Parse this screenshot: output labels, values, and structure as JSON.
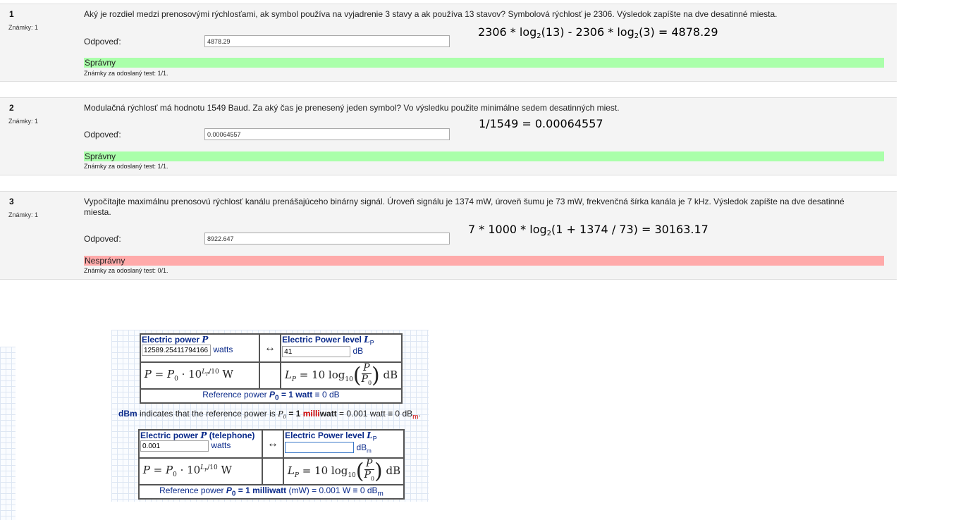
{
  "questions": [
    {
      "number": "1",
      "marks": "Známky: 1",
      "text": "Aký je rozdiel medzi prenosovými rýchlosťami, ak symbol používa na vyjadrenie 3 stavy a ak používa 13 stavov? Symbolová rýchlosť je 2306. Výsledok zapíšte na dve desatinné miesta.",
      "answer_label": "Odpoveď:",
      "answer_value": "4878.29",
      "annotation_prefix": "2306 * log",
      "annotation_mid1": "(13) - 2306 * log",
      "annotation_suffix": "(3) = 4878.29",
      "annotation_sub": "2",
      "result": "Správny",
      "status": "correct",
      "score": "Známky za odoslaný test: 1/1."
    },
    {
      "number": "2",
      "marks": "Známky: 1",
      "text": "Modulačná rýchlosť má hodnotu 1549 Baud. Za aký čas je prenesený jeden symbol? Vo výsledku použite minimálne sedem desatinných miest.",
      "answer_label": "Odpoveď:",
      "answer_value": "0.00064557",
      "annotation": "1/1549 = 0.00064557",
      "result": "Správny",
      "status": "correct",
      "score": "Známky za odoslaný test: 1/1."
    },
    {
      "number": "3",
      "marks": "Známky: 1",
      "text": "Vypočítajte maximálnu prenosovú rýchlosť kanálu prenášajúceho binárny signál. Úroveň signálu je 1374 mW, úroveň šumu je 73 mW, frekvenčná šírka kanála je 7 kHz. Výsledok zapíšte na dve desatinné miesta.",
      "answer_label": "Odpoveď:",
      "answer_value": "8922.647",
      "annotation_prefix": "7 * 1000 * log",
      "annotation_sub": "2",
      "annotation_suffix": "(1 + 1374 / 73) = 30163.17",
      "result": "Nesprávny",
      "status": "incorrect",
      "score": "Známky za odoslaný test: 0/1."
    }
  ],
  "calculator_watt": {
    "header_power": "Electric power",
    "header_power_symbol": "P",
    "header_level": "Electric Power level",
    "header_level_symbol": "L",
    "header_level_sub": "P",
    "power_value": "12589.25411794166",
    "power_unit": "watts",
    "level_value": "41",
    "level_unit": "dB",
    "arrow": "↔",
    "formula_left_a": "P = P",
    "formula_left_b": " · 10",
    "formula_left_exp": "LP/10",
    "formula_left_unit": "W",
    "formula_right_a": "L",
    "formula_right_b": " = 10 log",
    "formula_right_sub": "10",
    "formula_right_num": "P",
    "formula_right_den": "P0",
    "formula_right_unit": "dB",
    "reference_prefix": "Reference power",
    "reference_bold": "= 1 watt",
    "reference_suffix": "≡ 0 dB"
  },
  "dbm_note": {
    "dbm": "dBm",
    "text1": " indicates that the reference power is ",
    "bold": "= 1 ",
    "red": "milli",
    "bold2": "watt",
    "text2": " = 0.001 watt ≡ 0 dB",
    "sub": "m",
    "end": "."
  },
  "calculator_milliwatt": {
    "header_power": "Electric power",
    "header_power_symbol": "P",
    "header_power_extra": "(telephone)",
    "header_level": "Electric Power level",
    "header_level_symbol": "L",
    "header_level_sub": "P",
    "power_value": "0.001",
    "power_unit": "watts",
    "level_value": "",
    "level_unit": "dB",
    "level_unit_sub": "m",
    "arrow": "↔",
    "reference_prefix": "Reference power",
    "reference_bold": "= 1 milliwatt",
    "reference_suffix": "(mW) = 0.001 W ≡ 0 dB",
    "reference_sub": "m"
  }
}
